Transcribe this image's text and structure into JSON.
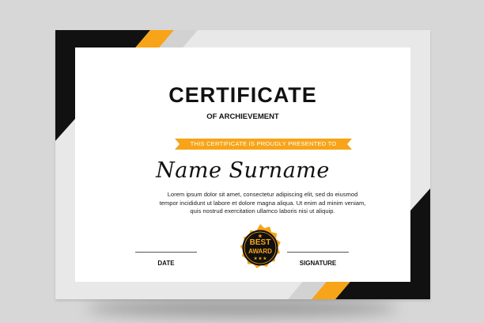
{
  "certificate": {
    "title": "CERTIFICATE",
    "subtitle": "OF ARCHIEVEMENT",
    "ribbon_text": "THIS CERTIFICATE IS PROUDLY PRESENTED TO",
    "recipient_name": "Name Surname",
    "body_lines": [
      "Lorem ipsum dolor sit amet, consectetur adipiscing elit, sed do eiusmod",
      "tempor incididunt ut labore et dolore magna aliqua. Ut enim ad minim veniam,",
      "quis nostrud exercitation ullamco laboris nisi ut aliquip."
    ],
    "date_label": "DATE",
    "signature_label": "SIGNATURE",
    "seal": {
      "line1": "BEST",
      "line2": "AWARD",
      "stars": "★ ★ ★",
      "top_star": "★"
    }
  },
  "colors": {
    "accent": "#f7a418",
    "dark": "#111111",
    "frame_gray": "#e6e6e6",
    "background": "#d7d7d7"
  }
}
